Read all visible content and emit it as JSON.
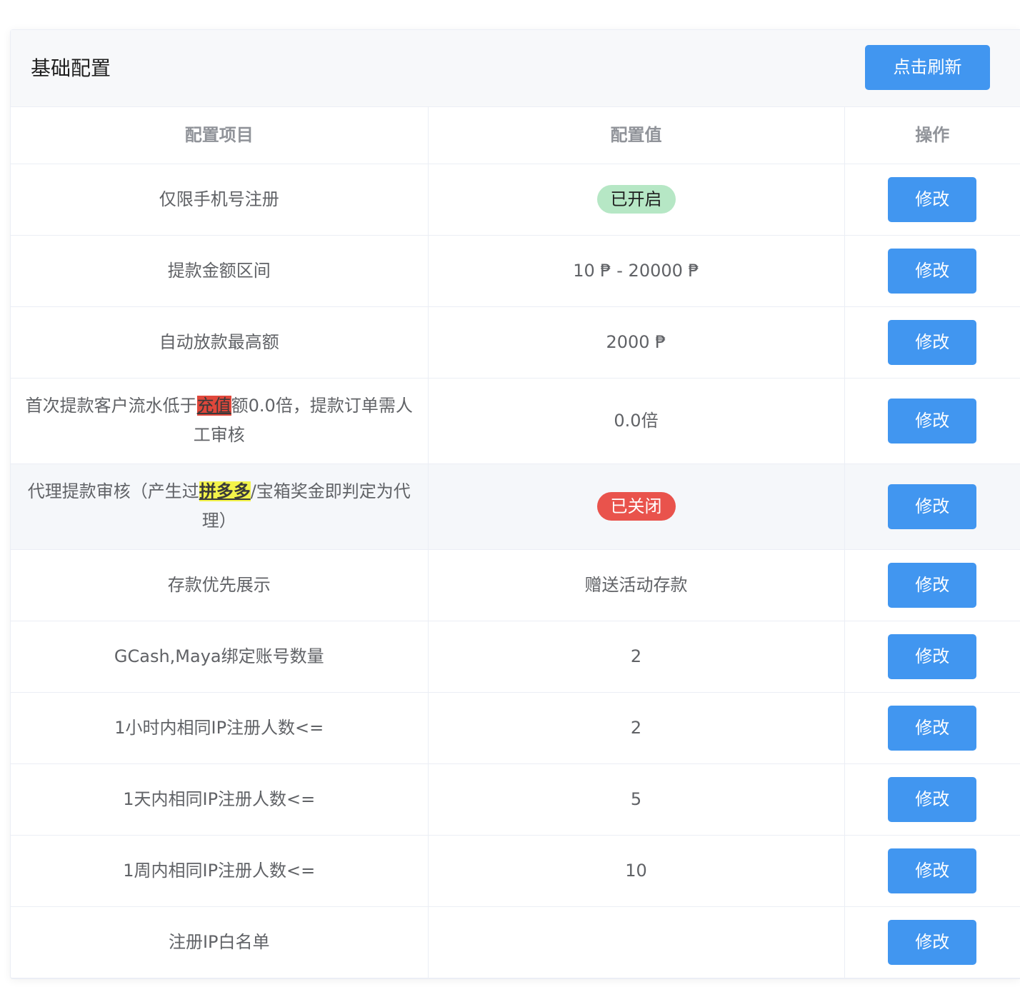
{
  "card": {
    "title": "基础配置",
    "refresh_label": "点击刷新"
  },
  "table": {
    "headers": [
      "配置项目",
      "配置值",
      "操作"
    ],
    "edit_label": "修改",
    "rows": [
      {
        "item": "仅限手机号注册",
        "value": "已开启",
        "value_type": "tag-on"
      },
      {
        "item": "提款金额区间",
        "value": "10 ₱ - 20000 ₱"
      },
      {
        "item": "自动放款最高额",
        "value": "2000 ₱"
      },
      {
        "item_prefix": "首次提款客户流水低于",
        "item_highlight": "充值",
        "item_suffix": "额0.0倍，提款订单需人工审核",
        "value": "0.0倍"
      },
      {
        "item_prefix": "代理提款审核（产生过",
        "item_highlight": "拼多多",
        "item_suffix": "/宝箱奖金即判定为代理）",
        "value": "已关闭",
        "value_type": "tag-off"
      },
      {
        "item": "存款优先展示",
        "value": "赠送活动存款"
      },
      {
        "item": "GCash,Maya绑定账号数量",
        "value": "2"
      },
      {
        "item": "1小时内相同IP注册人数<=",
        "value": "2"
      },
      {
        "item": "1天内相同IP注册人数<=",
        "value": "5"
      },
      {
        "item": "1周内相同IP注册人数<=",
        "value": "10"
      },
      {
        "item": "注册IP白名单",
        "value": ""
      }
    ]
  },
  "colors": {
    "primary": "#4196f0",
    "tag_on_bg": "#b6e7c5",
    "tag_off_bg": "#e9534c",
    "highlight_red": "#e0473b",
    "highlight_yellow": "#f3f34a"
  }
}
